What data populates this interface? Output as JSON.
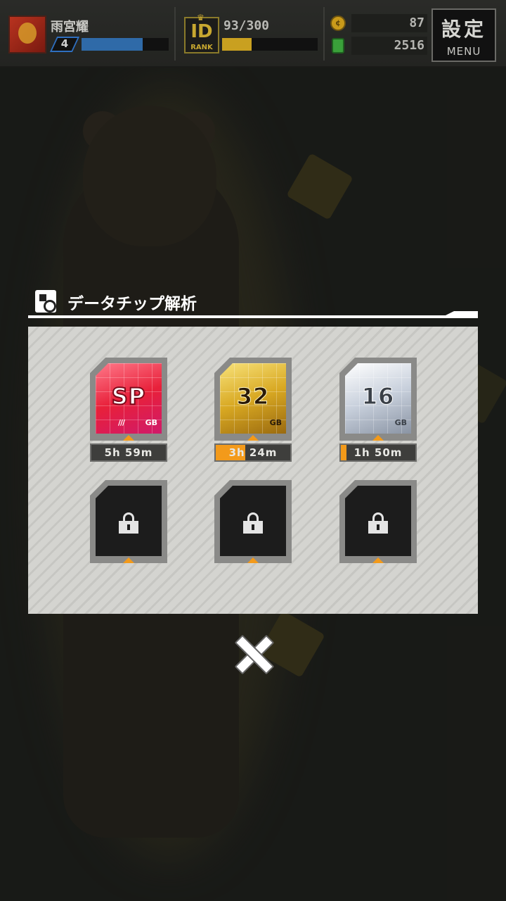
{
  "hud": {
    "player_name": "雨宮耀",
    "level": "4",
    "xp_fraction": 0.7,
    "rank_logo": "ID",
    "rank_word": "RANK",
    "stamina": "93/300",
    "stamina_fraction": 0.31,
    "coins": "87",
    "gems": "2516",
    "menu_kanji": "設定",
    "menu_label": "MENU"
  },
  "dialog": {
    "title": "データチップ解析",
    "slots": [
      {
        "chip": "SP",
        "unit": "GB",
        "timer": "5h 59m",
        "progress": 0.0,
        "locked": false
      },
      {
        "chip": "32",
        "unit": "GB",
        "timer": "3h 24m",
        "progress": 0.4,
        "locked": false
      },
      {
        "chip": "16",
        "unit": "GB",
        "timer": "1h 50m",
        "progress": 0.08,
        "locked": false
      },
      {
        "locked": true
      },
      {
        "locked": true
      },
      {
        "locked": true
      }
    ]
  },
  "colors": {
    "accent_orange": "#f39a1a",
    "xp_blue": "#2f6aa8",
    "stamina_gold": "#c9a020",
    "panel_bg": "#d4d4d0"
  },
  "icons": {
    "close": "close-icon",
    "lock": "lock-icon",
    "analysis": "chip-analysis-icon",
    "coin": "coin-icon",
    "gem": "gem-icon"
  }
}
